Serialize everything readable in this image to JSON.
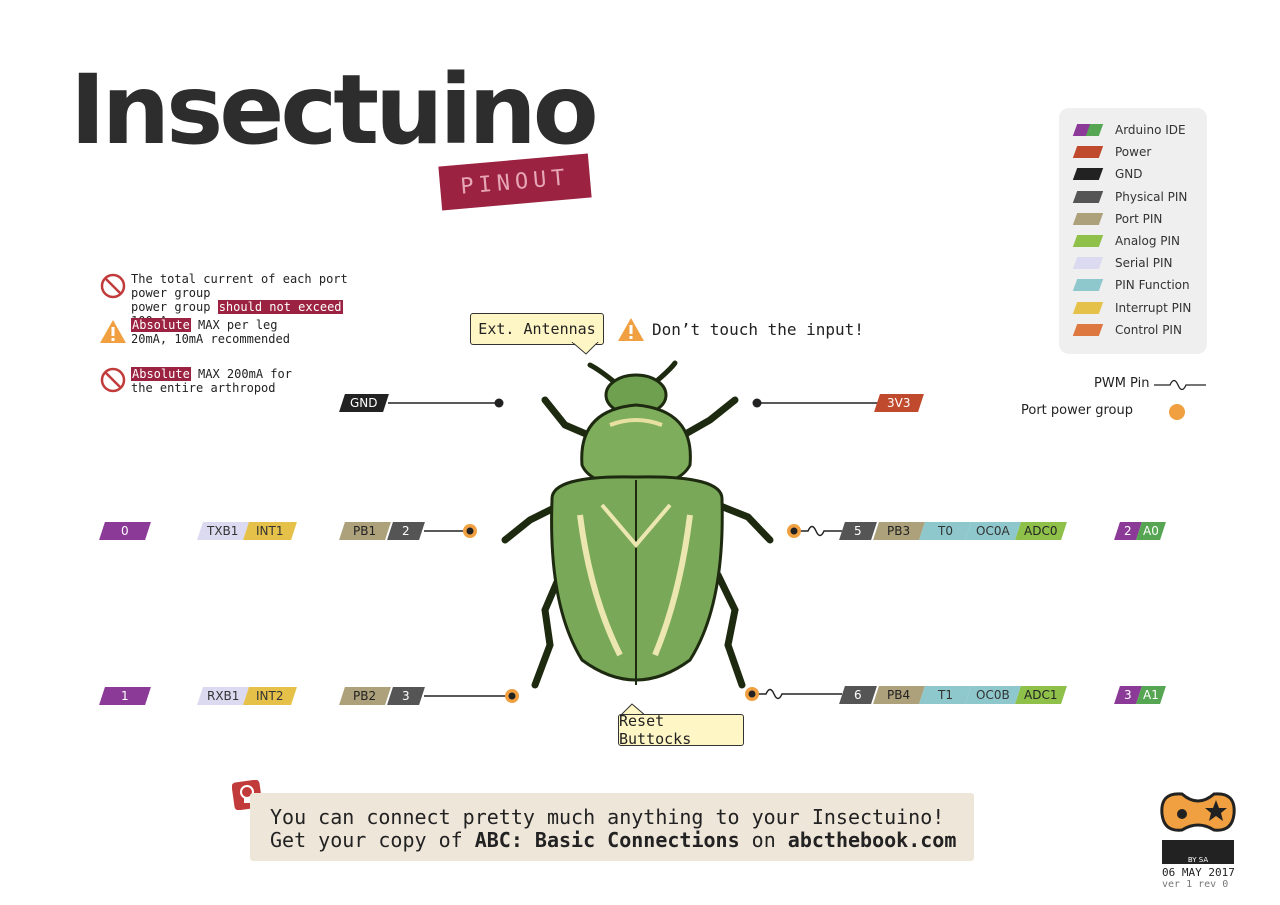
{
  "header": {
    "title": "Insectuino",
    "subtitle": "PINOUT"
  },
  "warnings": [
    {
      "icon": "no-entry-icon",
      "pre": "The total current of each port power group ",
      "highlight": "should not exceed",
      "post": " 100mA"
    },
    {
      "icon": "warning-triangle-icon",
      "highlight": "Absolute",
      "line1_rest": " MAX per leg",
      "line2": "20mA, 10mA recommended"
    },
    {
      "icon": "no-entry-icon",
      "highlight": "Absolute",
      "line1_rest": " MAX 200mA for",
      "line2": "the entire arthropod"
    }
  ],
  "legend": [
    {
      "label": "Arduino IDE",
      "color": "#8c3a98",
      "color2": "#55a552"
    },
    {
      "label": "Power",
      "color": "#c04a2e"
    },
    {
      "label": "GND",
      "color": "#222222"
    },
    {
      "label": "Physical PIN",
      "color": "#555555"
    },
    {
      "label": "Port PIN",
      "color": "#aca17b"
    },
    {
      "label": "Analog PIN",
      "color": "#8fc04a"
    },
    {
      "label": "Serial PIN",
      "color": "#dcdaf0"
    },
    {
      "label": "PIN Function",
      "color": "#8ec8cc"
    },
    {
      "label": "Interrupt PIN",
      "color": "#e6c14a"
    },
    {
      "label": "Control PIN",
      "color": "#dd7840"
    }
  ],
  "notes": {
    "pwm": "PWM Pin",
    "power_group": "Port power group"
  },
  "callouts": {
    "antennas": "Ext. Antennas",
    "dont_touch": "Don’t touch the input!",
    "reset": "Reset Buttocks"
  },
  "pins": {
    "gnd": "GND",
    "v33": "3V3",
    "left_top": {
      "ide": "0",
      "serial": "TXB1",
      "interrupt": "INT1",
      "port": "PB1",
      "phys": "2"
    },
    "left_bottom": {
      "ide": "1",
      "serial": "RXB1",
      "interrupt": "INT2",
      "port": "PB2",
      "phys": "3"
    },
    "right_top": {
      "phys": "5",
      "port": "PB3",
      "func1": "T0",
      "func2": "OC0A",
      "analog": "ADC0",
      "ide_d": "2",
      "ide_a": "A0"
    },
    "right_bottom": {
      "phys": "6",
      "port": "PB4",
      "func1": "T1",
      "func2": "OC0B",
      "analog": "ADC1",
      "ide_d": "3",
      "ide_a": "A1"
    }
  },
  "banner": {
    "line1": "You can connect pretty much anything to your Insectuino!",
    "line2_pre": "Get your copy of ",
    "line2_bold": "ABC: Basic Connections",
    "line2_mid": " on ",
    "line2_url": "abcthebook.com"
  },
  "footer": {
    "license": "BY SA",
    "date": "06 MAY 2017",
    "version": "ver 1 rev 0"
  }
}
